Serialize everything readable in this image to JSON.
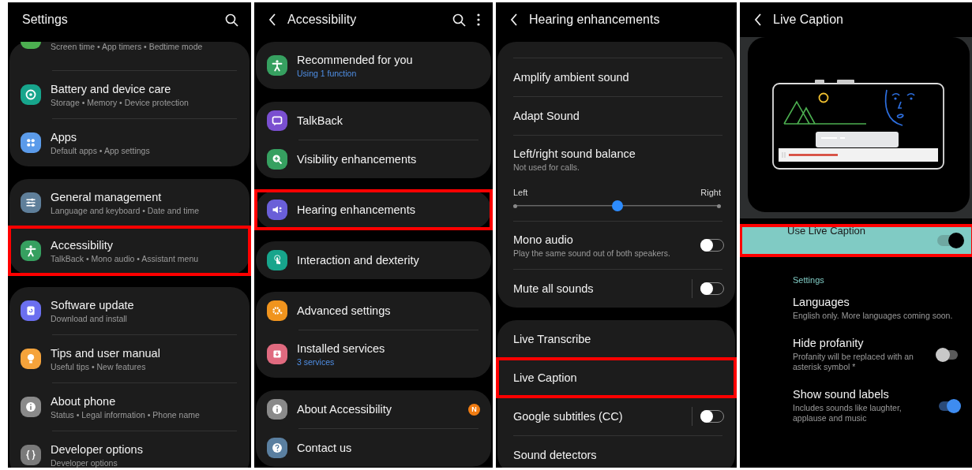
{
  "panels": [
    {
      "kind": "one_ui",
      "header": {
        "title": "Settings",
        "back": false,
        "search": true,
        "more": false
      },
      "groups": [
        {
          "items": [
            {
              "subtitle": "Screen time • App timers • Bedtime mode",
              "color": "#4caf50",
              "selected": false
            },
            {
              "title": "Battery and device care",
              "subtitle": "Storage • Memory • Device protection",
              "color": "#17a58c",
              "selected": false
            },
            {
              "title": "Apps",
              "subtitle": "Default apps • App settings",
              "color": "#5b9bea",
              "selected": false
            }
          ]
        },
        {
          "items": [
            {
              "title": "General management",
              "subtitle": "Language and keyboard • Date and time",
              "color": "#5f7f9a",
              "selected": false
            },
            {
              "title": "Accessibility",
              "subtitle": "TalkBack • Mono audio • Assistant menu",
              "color": "#36a060",
              "selected": true
            }
          ]
        },
        {
          "items": [
            {
              "title": "Software update",
              "subtitle": "Download and install",
              "color": "#6b6ff0",
              "selected": false
            },
            {
              "title": "Tips and user manual",
              "subtitle": "Useful tips • New features",
              "color": "#f5a33b",
              "selected": false
            },
            {
              "title": "About phone",
              "subtitle": "Status • Legal information • Phone name",
              "color": "#8a8a8a",
              "selected": false
            },
            {
              "title": "Developer options",
              "subtitle": "Developer options",
              "color": "#7a7a7a",
              "selected": false
            }
          ]
        }
      ]
    },
    {
      "kind": "one_ui",
      "header": {
        "title": "Accessibility",
        "back": true,
        "search": true,
        "more": true
      },
      "groups": [
        {
          "items": [
            {
              "title": "Recommended for you",
              "subtitle": "Using 1 function",
              "accent": true,
              "color": "#36a060",
              "selected": false
            }
          ]
        },
        {
          "items": [
            {
              "title": "TalkBack",
              "color": "#7a4fd0",
              "selected": false
            },
            {
              "title": "Visibility enhancements",
              "color": "#36a060",
              "selected": false
            }
          ]
        },
        {
          "items": [
            {
              "title": "Hearing enhancements",
              "color": "#6a5fd8",
              "selected": true
            }
          ]
        },
        {
          "items": [
            {
              "title": "Interaction and dexterity",
              "color": "#17a58c",
              "selected": false
            }
          ]
        },
        {
          "items": [
            {
              "title": "Advanced settings",
              "color": "#f0941e",
              "selected": false
            },
            {
              "title": "Installed services",
              "subtitle": "3 services",
              "accent": true,
              "color": "#e06a7f",
              "selected": false
            }
          ]
        },
        {
          "items": [
            {
              "title": "About Accessibility",
              "badge": "N",
              "color": "#8a8a8a",
              "selected": false
            },
            {
              "title": "Contact us",
              "color": "#5a7fa0",
              "selected": false
            }
          ]
        }
      ]
    },
    {
      "kind": "one_ui",
      "header": {
        "title": "Hearing enhancements",
        "back": true,
        "search": false,
        "more": false
      },
      "groups": [
        {
          "cut_top": true,
          "items": [
            {
              "kind": "link",
              "title": "Amplify ambient sound",
              "selected": false
            },
            {
              "kind": "link",
              "title": "Adapt Sound",
              "selected": false
            },
            {
              "kind": "link",
              "title": "Left/right sound balance",
              "subtitle": "Not used for calls.",
              "selected": false
            },
            {
              "kind": "slider",
              "left_label": "Left",
              "right_label": "Right",
              "level": 0.5
            },
            {
              "kind": "toggle",
              "title": "Mono audio",
              "subtitle": "Play the same sound out of both speakers.",
              "on": false,
              "split": false,
              "selected": false
            },
            {
              "kind": "toggle",
              "title": "Mute all sounds",
              "on": false,
              "split": true,
              "selected": false
            }
          ]
        },
        {
          "items": [
            {
              "kind": "link",
              "title": "Live Transcribe",
              "selected": false
            },
            {
              "kind": "link",
              "title": "Live Caption",
              "selected": true
            },
            {
              "kind": "toggle",
              "title": "Google subtitles (CC)",
              "on": false,
              "split": true,
              "selected": false
            },
            {
              "kind": "link",
              "title": "Sound detectors",
              "selected": false
            }
          ]
        }
      ]
    },
    {
      "kind": "material",
      "header": {
        "title": "Live Caption",
        "back": true,
        "search": false,
        "more": false
      },
      "master": {
        "label": "Use Live Caption",
        "on": true,
        "selected": true
      },
      "section": "Settings",
      "items": [
        {
          "kind": "link",
          "title": "Languages",
          "subtitle": "English only. More languages coming soon."
        },
        {
          "kind": "toggle",
          "title": "Hide profanity",
          "subtitle": "Profanity will be replaced with an asterisk symbol *",
          "on": false
        },
        {
          "kind": "toggle",
          "title": "Show sound labels",
          "subtitle": "Includes sounds like laughter, applause and music",
          "on": true
        }
      ]
    }
  ]
}
